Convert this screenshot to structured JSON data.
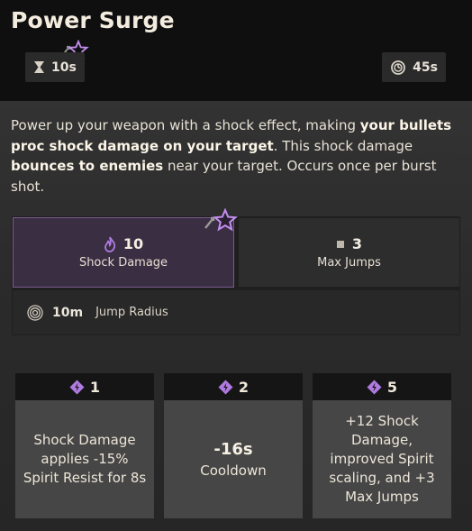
{
  "ability": {
    "title": "Power Surge",
    "duration": "10s",
    "cooldown": "45s"
  },
  "description": {
    "part1": "Power up your weapon with a shock effect, making ",
    "bold1": "your bullets proc shock damage on your target",
    "part2": ". This shock damage ",
    "bold2": "bounces to enemies",
    "part3": " near your target. Occurs once per burst shot."
  },
  "stats": {
    "shock_damage": {
      "value": "10",
      "label": "Shock Damage"
    },
    "max_jumps": {
      "value": "3",
      "label": "Max Jumps"
    },
    "jump_radius": {
      "value": "10m",
      "label": "Jump Radius"
    }
  },
  "upgrades": [
    {
      "cost": "1",
      "text": "Shock Damage applies -15% Spirit Resist for 8s"
    },
    {
      "cost": "2",
      "value": "-16s",
      "text": "Cooldown"
    },
    {
      "cost": "5",
      "text": "+12 Shock Damage, improved Spirit scaling, and +3 Max Jumps"
    }
  ],
  "colors": {
    "spirit_purple": "#b07be0",
    "highlight_border": "#7b5a8e"
  },
  "icons": {
    "duration": "hourglass-icon",
    "cooldown": "cooldown-clock-icon",
    "shock_damage": "spirit-flame-icon",
    "max_jumps": "square-icon",
    "jump_radius": "radius-rings-icon",
    "upgrade_cost": "spirit-point-icon",
    "upgraded": "upgrade-star-icon"
  }
}
